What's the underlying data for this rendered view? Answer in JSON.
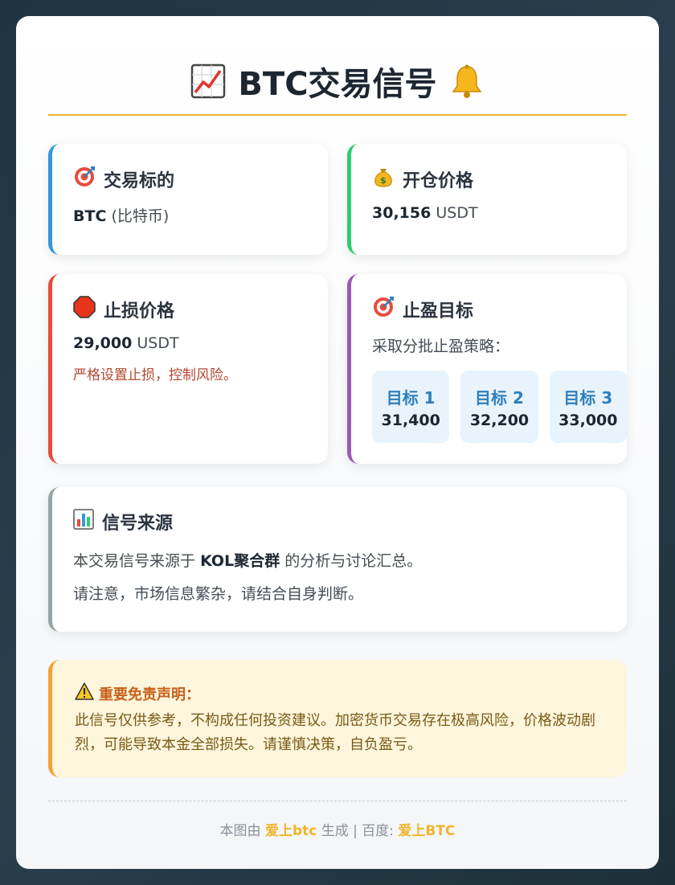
{
  "header": {
    "title": "BTC交易信号",
    "left_icon": "chart-increasing-icon",
    "right_icon": "bell-icon"
  },
  "asset": {
    "title": "交易标的",
    "icon": "target-icon",
    "symbol": "BTC",
    "name": "(比特币)"
  },
  "entry": {
    "title": "开仓价格",
    "icon": "money-bag-icon",
    "price": "30,156",
    "unit": "USDT"
  },
  "stop_loss": {
    "title": "止损价格",
    "icon": "stop-sign-icon",
    "price": "29,000",
    "unit": "USDT",
    "note": "严格设置止损，控制风险。"
  },
  "take_profit": {
    "title": "止盈目标",
    "icon": "target-icon",
    "strategy": "采取分批止盈策略：",
    "targets": [
      {
        "label": "目标 1",
        "value": "31,400"
      },
      {
        "label": "目标 2",
        "value": "32,200"
      },
      {
        "label": "目标 3",
        "value": "33,000"
      }
    ]
  },
  "source": {
    "title": "信号来源",
    "icon": "bar-chart-icon",
    "line1_prefix": "本交易信号来源于",
    "line1_group": "KOL聚合群",
    "line1_suffix": "的分析与讨论汇总。",
    "line2": "请注意，市场信息繁杂，请结合自身判断。"
  },
  "disclaimer": {
    "icon": "warning-icon",
    "title": "重要免责声明：",
    "body": "此信号仅供参考，不构成任何投资建议。加密货币交易存在极高风险，价格波动剧烈，可能导致本金全部损失。请谨慎决策，自负盈亏。"
  },
  "footer": {
    "prefix": "本图由",
    "brand": "爱上btc",
    "middle": "生成 | 百度:",
    "baidu": "爱上BTC"
  },
  "colors": {
    "accent": "#f0b429",
    "blue": "#3498db",
    "green": "#2ecc71",
    "red": "#e74c3c",
    "purple": "#9b59b6",
    "gray": "#95a5a6",
    "warning": "#f0a23a"
  }
}
